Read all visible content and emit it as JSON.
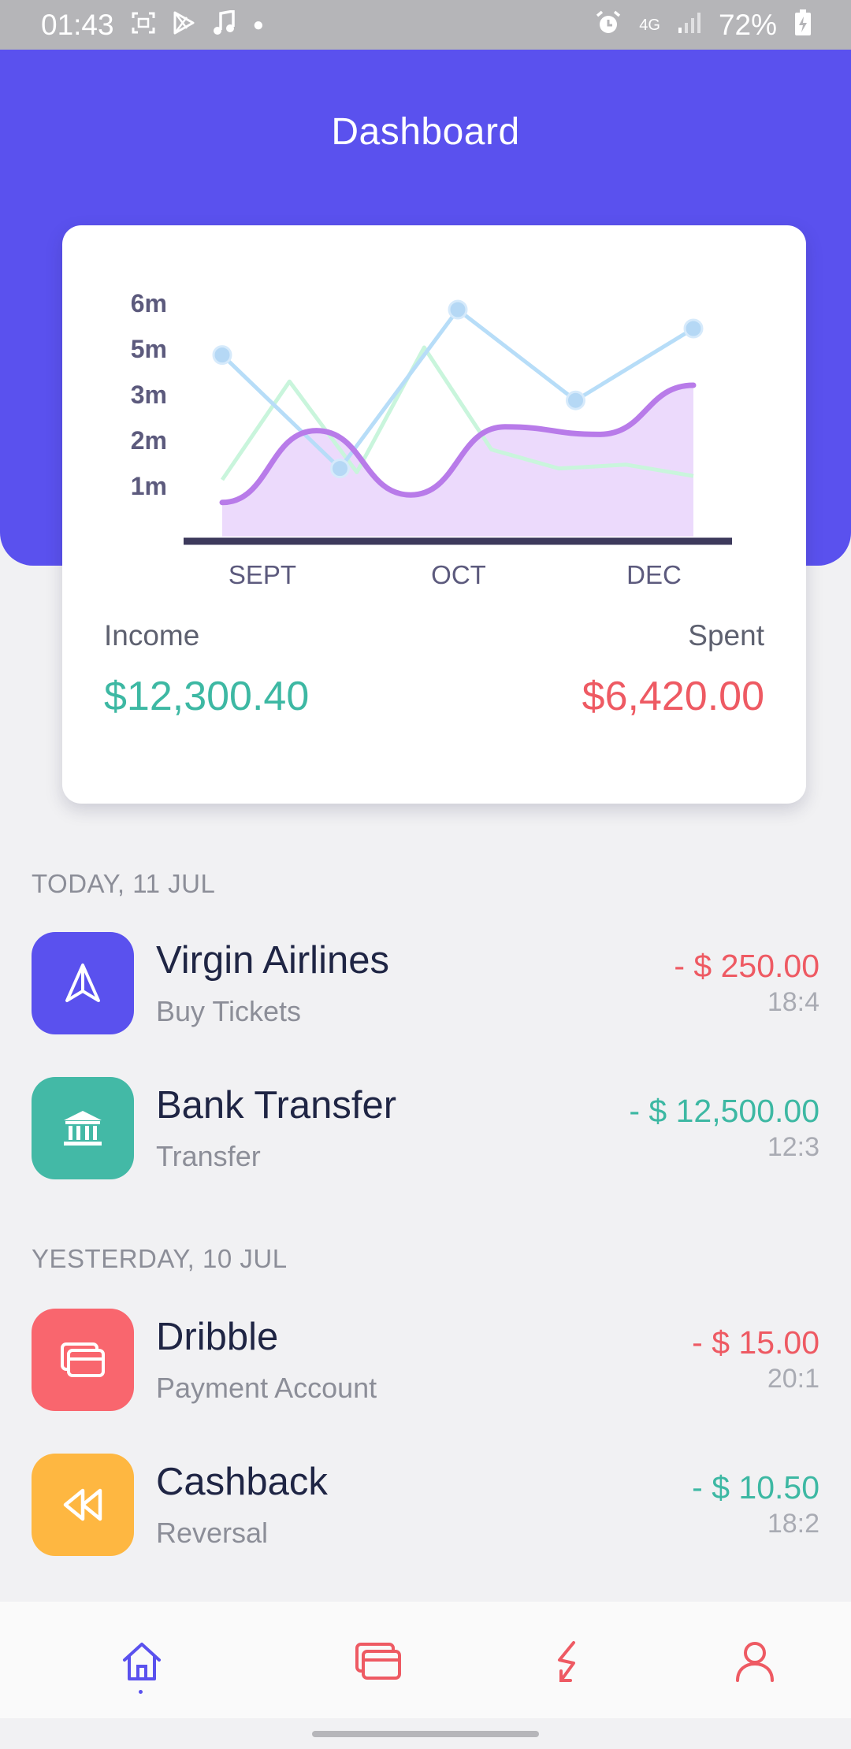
{
  "status_bar": {
    "time": "01:43",
    "network": "4G",
    "battery": "72%",
    "icons": [
      "screenshot-icon",
      "play-store-icon",
      "music-note-icon",
      "alarm-icon",
      "signal-icon",
      "battery-charging-icon"
    ]
  },
  "header": {
    "title": "Dashboard",
    "color": "#5a51ee"
  },
  "summary": {
    "income_label": "Income",
    "income_value": "$12,300.40",
    "spent_label": "Spent",
    "spent_value": "$6,420.00"
  },
  "chart_data": {
    "type": "line",
    "title": "",
    "xlabel": "",
    "ylabel": "",
    "y_tick_labels": [
      "6m",
      "5m",
      "3m",
      "2m",
      "1m"
    ],
    "x_tick_labels": [
      "SEPT",
      "OCT",
      "DEC"
    ],
    "series": [
      {
        "color": "#b7ddf8",
        "marker": "circle",
        "x": [
          0,
          1,
          2,
          3,
          4
        ],
        "y": [
          4.8,
          1.8,
          6.0,
          3.6,
          5.5
        ]
      },
      {
        "color": "#c9f5dc",
        "marker": "none",
        "x": [
          0,
          1,
          2,
          3,
          4,
          5,
          6,
          7
        ],
        "y": [
          1.5,
          4.1,
          1.7,
          5.0,
          2.3,
          1.8,
          1.9,
          1.6
        ]
      },
      {
        "color": "#b87be9",
        "fill": "#ecdafc",
        "marker": "none",
        "x": [
          0,
          1,
          2,
          3,
          4,
          5
        ],
        "y": [
          0.9,
          2.8,
          1.1,
          2.9,
          2.7,
          4.0
        ]
      }
    ]
  },
  "sections": [
    {
      "heading": "TODAY, 11 JUL",
      "items": [
        {
          "title": "Virgin Airlines",
          "subtitle": "Buy Tickets",
          "amount": "- $ 250.00",
          "time": "18:4",
          "amount_color": "#ee5a63",
          "icon": "paper-plane-icon",
          "icon_bg": "#5a51ee"
        },
        {
          "title": "Bank Transfer",
          "subtitle": "Transfer",
          "amount": "- $ 12,500.00",
          "time": "12:3",
          "amount_color": "#3db8a3",
          "icon": "bank-icon",
          "icon_bg": "#43b9a6"
        }
      ]
    },
    {
      "heading": "YESTERDAY, 10 JUL",
      "items": [
        {
          "title": "Dribble",
          "subtitle": "Payment Account",
          "amount": "- $ 15.00",
          "time": "20:1",
          "amount_color": "#ee5a63",
          "icon": "wallet-icon",
          "icon_bg": "#f9666e"
        },
        {
          "title": "Cashback",
          "subtitle": "Reversal",
          "amount": "- $ 10.50",
          "time": "18:2",
          "amount_color": "#3db8a3",
          "icon": "rewind-icon",
          "icon_bg": "#feb741"
        }
      ]
    }
  ],
  "bottom_nav": {
    "active": "home",
    "items": [
      "home-icon",
      "wallet-icon",
      "lightning-icon",
      "profile-icon"
    ],
    "active_color": "#5a51ee",
    "inactive_color": "#ee5a63"
  }
}
